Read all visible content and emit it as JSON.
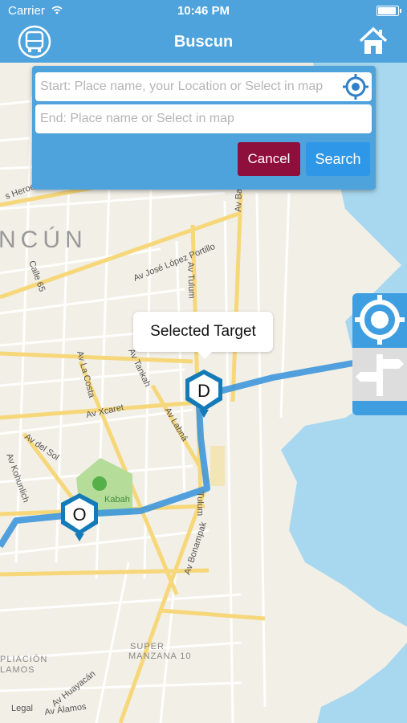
{
  "status": {
    "carrier": "Carrier",
    "time": "10:46 PM",
    "battery_level": 1.0
  },
  "navbar": {
    "title": "Buscun",
    "left_icon": "bus-icon",
    "right_icon": "home-icon"
  },
  "search_panel": {
    "start_placeholder": "Start: Place name, your Location or Select in map",
    "end_placeholder": "End: Place name or Select in map",
    "cancel_label": "Cancel",
    "search_label": "Search",
    "locate_icon": "crosshair-icon"
  },
  "side_buttons": {
    "locate_icon": "crosshair-icon",
    "route_icon": "signpost-icon"
  },
  "callout": {
    "text": "Selected Target"
  },
  "markers": {
    "origin": "O",
    "destination": "D"
  },
  "map_labels": {
    "city": "NCÚN",
    "street_heroes": "s Heroes",
    "jose_lopez": "Av José López Portillo",
    "tulum_upper": "Av Tulum",
    "calle65": "Calle 65",
    "la_costa": "Av La Costa",
    "tankah": "Av Tankah",
    "xcaret": "Av Xcaret",
    "labna": "Av Labná",
    "del_sol": "Av del Sol",
    "kohunlich": "Av Kohunlich",
    "kabah": "Kabah",
    "tulum_lower": "Tulum",
    "bonampak": "Av Bonampak",
    "ampliacion": "PLIACIÓN",
    "alamos_area": "LAMOS",
    "super": "SUPER",
    "manzana": "MANZANA 10",
    "huayacan": "Av Huayacán",
    "alamos": "Av Álamos",
    "ba": "Av Ba",
    "legal": "Legal"
  },
  "colors": {
    "accent": "#4ea3dd",
    "cancel": "#8e0f3c",
    "search": "#2f97e7",
    "route": "#3f97db",
    "water": "#a8d8ef",
    "marker": "#157bb8"
  }
}
